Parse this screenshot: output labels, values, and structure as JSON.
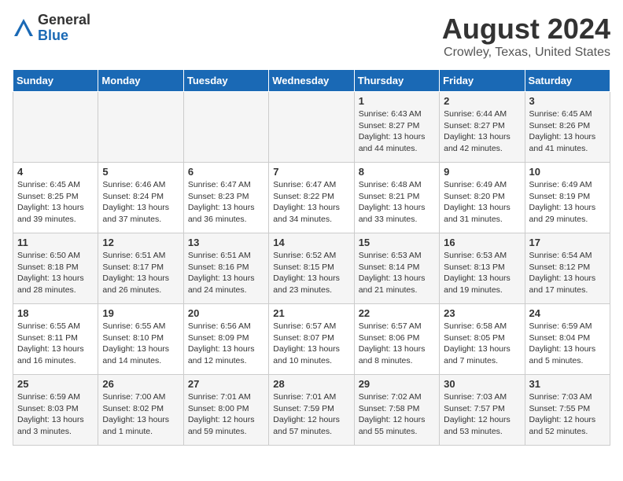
{
  "header": {
    "logo_general": "General",
    "logo_blue": "Blue",
    "main_title": "August 2024",
    "subtitle": "Crowley, Texas, United States"
  },
  "weekdays": [
    "Sunday",
    "Monday",
    "Tuesday",
    "Wednesday",
    "Thursday",
    "Friday",
    "Saturday"
  ],
  "weeks": [
    [
      {
        "day": "",
        "sunrise": "",
        "sunset": "",
        "daylight": ""
      },
      {
        "day": "",
        "sunrise": "",
        "sunset": "",
        "daylight": ""
      },
      {
        "day": "",
        "sunrise": "",
        "sunset": "",
        "daylight": ""
      },
      {
        "day": "",
        "sunrise": "",
        "sunset": "",
        "daylight": ""
      },
      {
        "day": "1",
        "sunrise": "Sunrise: 6:43 AM",
        "sunset": "Sunset: 8:27 PM",
        "daylight": "Daylight: 13 hours and 44 minutes."
      },
      {
        "day": "2",
        "sunrise": "Sunrise: 6:44 AM",
        "sunset": "Sunset: 8:27 PM",
        "daylight": "Daylight: 13 hours and 42 minutes."
      },
      {
        "day": "3",
        "sunrise": "Sunrise: 6:45 AM",
        "sunset": "Sunset: 8:26 PM",
        "daylight": "Daylight: 13 hours and 41 minutes."
      }
    ],
    [
      {
        "day": "4",
        "sunrise": "Sunrise: 6:45 AM",
        "sunset": "Sunset: 8:25 PM",
        "daylight": "Daylight: 13 hours and 39 minutes."
      },
      {
        "day": "5",
        "sunrise": "Sunrise: 6:46 AM",
        "sunset": "Sunset: 8:24 PM",
        "daylight": "Daylight: 13 hours and 37 minutes."
      },
      {
        "day": "6",
        "sunrise": "Sunrise: 6:47 AM",
        "sunset": "Sunset: 8:23 PM",
        "daylight": "Daylight: 13 hours and 36 minutes."
      },
      {
        "day": "7",
        "sunrise": "Sunrise: 6:47 AM",
        "sunset": "Sunset: 8:22 PM",
        "daylight": "Daylight: 13 hours and 34 minutes."
      },
      {
        "day": "8",
        "sunrise": "Sunrise: 6:48 AM",
        "sunset": "Sunset: 8:21 PM",
        "daylight": "Daylight: 13 hours and 33 minutes."
      },
      {
        "day": "9",
        "sunrise": "Sunrise: 6:49 AM",
        "sunset": "Sunset: 8:20 PM",
        "daylight": "Daylight: 13 hours and 31 minutes."
      },
      {
        "day": "10",
        "sunrise": "Sunrise: 6:49 AM",
        "sunset": "Sunset: 8:19 PM",
        "daylight": "Daylight: 13 hours and 29 minutes."
      }
    ],
    [
      {
        "day": "11",
        "sunrise": "Sunrise: 6:50 AM",
        "sunset": "Sunset: 8:18 PM",
        "daylight": "Daylight: 13 hours and 28 minutes."
      },
      {
        "day": "12",
        "sunrise": "Sunrise: 6:51 AM",
        "sunset": "Sunset: 8:17 PM",
        "daylight": "Daylight: 13 hours and 26 minutes."
      },
      {
        "day": "13",
        "sunrise": "Sunrise: 6:51 AM",
        "sunset": "Sunset: 8:16 PM",
        "daylight": "Daylight: 13 hours and 24 minutes."
      },
      {
        "day": "14",
        "sunrise": "Sunrise: 6:52 AM",
        "sunset": "Sunset: 8:15 PM",
        "daylight": "Daylight: 13 hours and 23 minutes."
      },
      {
        "day": "15",
        "sunrise": "Sunrise: 6:53 AM",
        "sunset": "Sunset: 8:14 PM",
        "daylight": "Daylight: 13 hours and 21 minutes."
      },
      {
        "day": "16",
        "sunrise": "Sunrise: 6:53 AM",
        "sunset": "Sunset: 8:13 PM",
        "daylight": "Daylight: 13 hours and 19 minutes."
      },
      {
        "day": "17",
        "sunrise": "Sunrise: 6:54 AM",
        "sunset": "Sunset: 8:12 PM",
        "daylight": "Daylight: 13 hours and 17 minutes."
      }
    ],
    [
      {
        "day": "18",
        "sunrise": "Sunrise: 6:55 AM",
        "sunset": "Sunset: 8:11 PM",
        "daylight": "Daylight: 13 hours and 16 minutes."
      },
      {
        "day": "19",
        "sunrise": "Sunrise: 6:55 AM",
        "sunset": "Sunset: 8:10 PM",
        "daylight": "Daylight: 13 hours and 14 minutes."
      },
      {
        "day": "20",
        "sunrise": "Sunrise: 6:56 AM",
        "sunset": "Sunset: 8:09 PM",
        "daylight": "Daylight: 13 hours and 12 minutes."
      },
      {
        "day": "21",
        "sunrise": "Sunrise: 6:57 AM",
        "sunset": "Sunset: 8:07 PM",
        "daylight": "Daylight: 13 hours and 10 minutes."
      },
      {
        "day": "22",
        "sunrise": "Sunrise: 6:57 AM",
        "sunset": "Sunset: 8:06 PM",
        "daylight": "Daylight: 13 hours and 8 minutes."
      },
      {
        "day": "23",
        "sunrise": "Sunrise: 6:58 AM",
        "sunset": "Sunset: 8:05 PM",
        "daylight": "Daylight: 13 hours and 7 minutes."
      },
      {
        "day": "24",
        "sunrise": "Sunrise: 6:59 AM",
        "sunset": "Sunset: 8:04 PM",
        "daylight": "Daylight: 13 hours and 5 minutes."
      }
    ],
    [
      {
        "day": "25",
        "sunrise": "Sunrise: 6:59 AM",
        "sunset": "Sunset: 8:03 PM",
        "daylight": "Daylight: 13 hours and 3 minutes."
      },
      {
        "day": "26",
        "sunrise": "Sunrise: 7:00 AM",
        "sunset": "Sunset: 8:02 PM",
        "daylight": "Daylight: 13 hours and 1 minute."
      },
      {
        "day": "27",
        "sunrise": "Sunrise: 7:01 AM",
        "sunset": "Sunset: 8:00 PM",
        "daylight": "Daylight: 12 hours and 59 minutes."
      },
      {
        "day": "28",
        "sunrise": "Sunrise: 7:01 AM",
        "sunset": "Sunset: 7:59 PM",
        "daylight": "Daylight: 12 hours and 57 minutes."
      },
      {
        "day": "29",
        "sunrise": "Sunrise: 7:02 AM",
        "sunset": "Sunset: 7:58 PM",
        "daylight": "Daylight: 12 hours and 55 minutes."
      },
      {
        "day": "30",
        "sunrise": "Sunrise: 7:03 AM",
        "sunset": "Sunset: 7:57 PM",
        "daylight": "Daylight: 12 hours and 53 minutes."
      },
      {
        "day": "31",
        "sunrise": "Sunrise: 7:03 AM",
        "sunset": "Sunset: 7:55 PM",
        "daylight": "Daylight: 12 hours and 52 minutes."
      }
    ]
  ]
}
